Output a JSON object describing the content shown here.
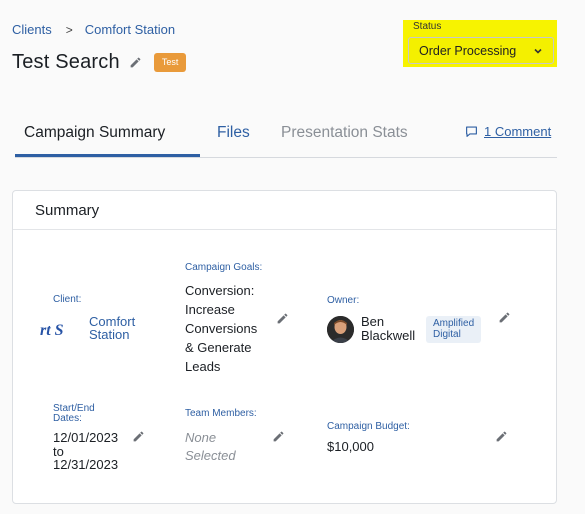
{
  "breadcrumb": {
    "root": "Clients",
    "separator": ">",
    "current": "Comfort Station"
  },
  "header": {
    "title": "Test Search",
    "badge": "Test",
    "edit_icon": "pencil-icon"
  },
  "status": {
    "label": "Status",
    "value": "Order Processing",
    "icon": "chevron-down-icon",
    "highlight_color": "#f7f300"
  },
  "tabs": [
    {
      "label": "Campaign Summary",
      "active": true
    },
    {
      "label": "Files",
      "active": false
    },
    {
      "label": "Presentation Stats",
      "active": false
    }
  ],
  "comments": {
    "label": "1 Comment",
    "icon": "comment-icon"
  },
  "summary": {
    "title": "Summary",
    "client": {
      "label": "Client:",
      "logo_text": "rt S",
      "value": "Comfort Station"
    },
    "campaign_goals": {
      "label": "Campaign Goals:",
      "lines": [
        "Conversion:",
        "Increase",
        "Conversions",
        "& Generate",
        "Leads"
      ]
    },
    "owner": {
      "label": "Owner:",
      "first": "Ben",
      "last": "Blackwell",
      "company_line1": "Amplified",
      "company_line2": "Digital"
    },
    "dates": {
      "label_line1": "Start/End",
      "label_line2": "Dates:",
      "start": "12/01/2023",
      "to": "to",
      "end": "12/31/2023"
    },
    "team_members": {
      "label": "Team Members:",
      "value_line1": "None",
      "value_line2": "Selected"
    },
    "budget": {
      "label": "Campaign Budget:",
      "value": "$10,000"
    }
  },
  "colors": {
    "accent": "#2e5fa3",
    "badge": "#e99a3a"
  }
}
